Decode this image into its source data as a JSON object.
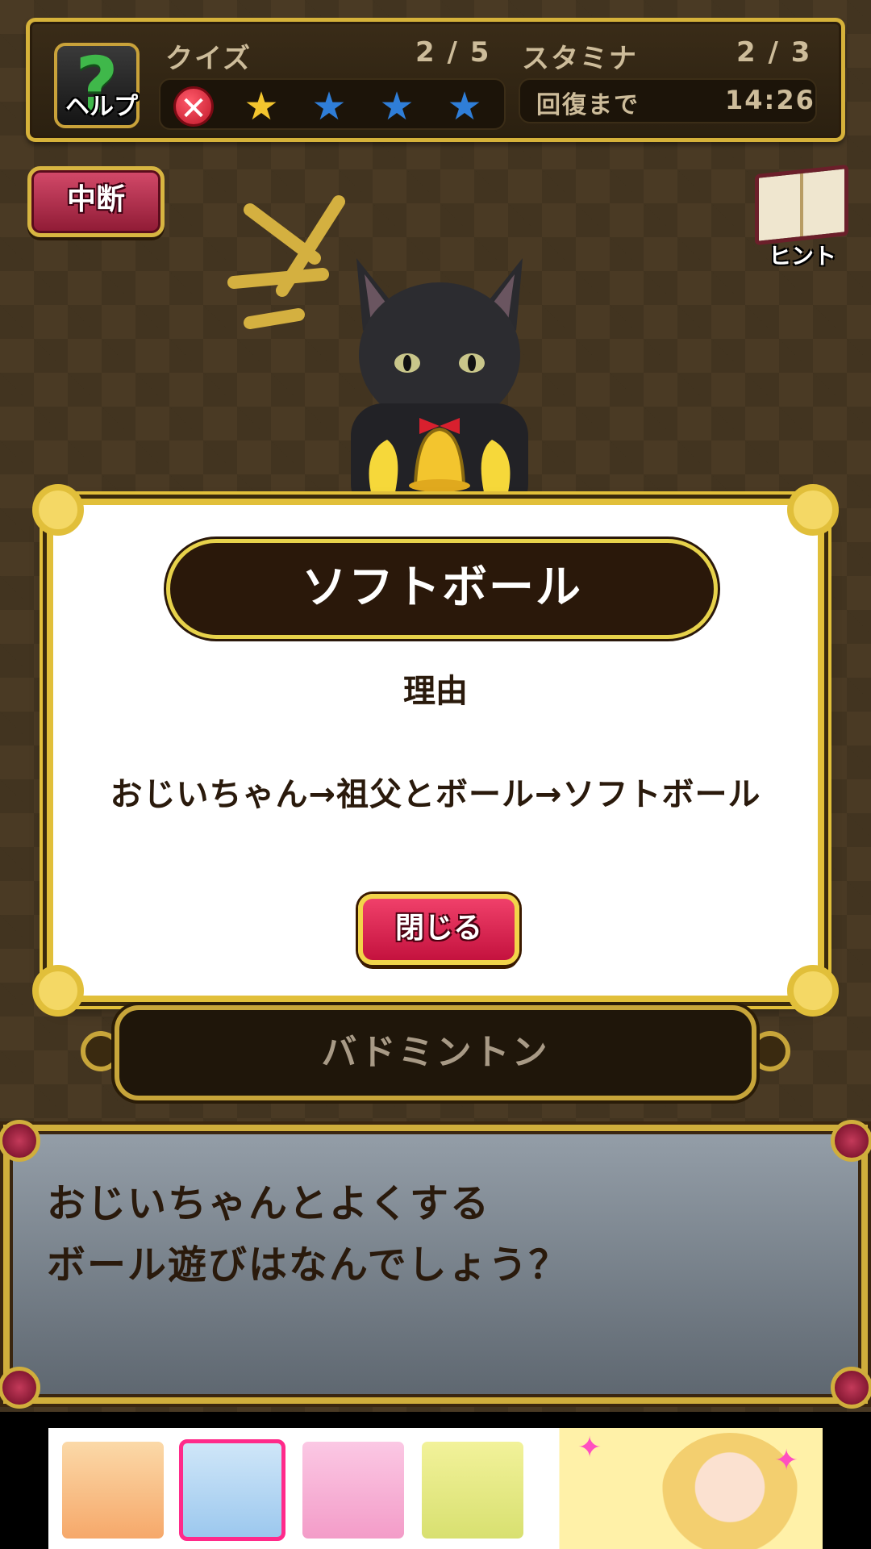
{
  "hud": {
    "help_label": "ヘルプ",
    "quiz_label": "クイズ",
    "quiz_progress": "2 / 5",
    "stamina_label": "スタミナ",
    "stamina_value": "2 / 3",
    "recover_label": "回復まで",
    "recover_time": "14:26",
    "results": [
      "wrong",
      "correct",
      "pending",
      "pending",
      "pending"
    ]
  },
  "pause_label": "中断",
  "hint_label": "ヒント",
  "modal": {
    "answer": "ソフトボール",
    "reason_title": "理由",
    "reason_text": "おじいちゃん→祖父とボール→ソフトボール",
    "close_label": "閉じる"
  },
  "choice_label": "バドミントン",
  "question": {
    "line1": "おじいちゃんとよくする",
    "line2": "ボール遊びはなんでしょう？"
  },
  "colors": {
    "gold": "#e1bf3a",
    "banner_dark": "#2a180a",
    "close_pink": "#e0285a",
    "star_gold": "#f3c52e",
    "star_blue": "#2f7ed8",
    "wrong_red": "#d81b2e"
  },
  "icons": {
    "help": "question-mark-icon",
    "wrong": "x-circle-icon",
    "star": "star-icon",
    "hint": "open-book-icon"
  }
}
